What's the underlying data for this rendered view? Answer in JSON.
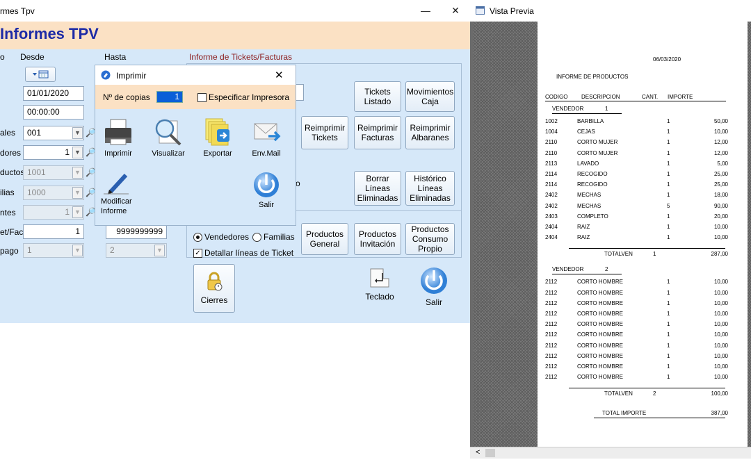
{
  "main": {
    "window_title": "rmes Tpv",
    "minimize": "—",
    "close": "✕",
    "header_title": "Informes TPV",
    "col_desde": "Desde",
    "col_hasta": "Hasta",
    "report_title": "Informe de Tickets/Facturas",
    "desde_date": "01/01/2020",
    "desde_time": "00:00:00",
    "labels": {
      "locales": "ales",
      "vendedores": "dores",
      "productos": "ductos",
      "familias": "ilias",
      "clientes": "ntes",
      "ticket_fac": "et/Fac",
      "forma_pago": "pago"
    },
    "locales_value": "001",
    "vendedores_value": "1",
    "productos_value": "1001",
    "familias_value": "1000",
    "clientes_value": "1",
    "ticket_desde": "1",
    "ticket_hasta": "9999999999",
    "pago_desde": "1",
    "pago_hasta": "2",
    "buttons": {
      "tickets_listado": "Tickets\nListado",
      "movimientos_caja": "Movimientos\nCaja",
      "reimprimir_tickets": "Reimprimir\nTickets",
      "reimprimir_facturas": "Reimprimir\nFacturas",
      "reimprimir_albaranes": "Reimprimir\nAlbaranes",
      "borrar_lineas": "Borrar\nLíneas\nEliminadas",
      "historico_lineas": "Histórico\nLíneas\nEliminadas",
      "productos_general": "Productos\nGeneral",
      "productos_invitacion": "Productos\nInvitación",
      "productos_consumo": "Productos\nConsumo\nPropio",
      "cierres": "Cierres",
      "teclado": "Teclado",
      "salir": "Salir"
    },
    "radio_vendedores": "Vendedores",
    "radio_familias": "Familias",
    "check_detallar": "Detallar líneas de Ticket"
  },
  "dialog": {
    "title": "Imprimir",
    "close": "✕",
    "copies_label": "Nº de copias",
    "copies_value": "1",
    "specify_printer": "Especificar Impresora",
    "actions": {
      "imprimir": "Imprimir",
      "visualizar": "Visualizar",
      "exportar": "Exportar",
      "envmail": "Env.Mail",
      "modificar": "Modificar\nInforme",
      "salir": "Salir"
    }
  },
  "preview": {
    "title": "Vista Previa",
    "scroll_left": "<",
    "report": {
      "date": "06/03/2020",
      "heading": "INFORME DE PRODUCTOS",
      "cols": {
        "codigo": "CODIGO",
        "descripcion": "DESCRIPCION",
        "cant": "CANT.",
        "importe": "IMPORTE"
      },
      "groups": [
        {
          "label": "VENDEDOR",
          "num": "1",
          "rows": [
            {
              "code": "1002",
              "desc": "BARBILLA",
              "qty": "1",
              "amt": "50,00"
            },
            {
              "code": "1004",
              "desc": "CEJAS",
              "qty": "1",
              "amt": "10,00"
            },
            {
              "code": "2110",
              "desc": "CORTO MUJER",
              "qty": "1",
              "amt": "12,00"
            },
            {
              "code": "2110",
              "desc": "CORTO MUJER",
              "qty": "1",
              "amt": "12,00"
            },
            {
              "code": "2113",
              "desc": "LAVADO",
              "qty": "1",
              "amt": "5,00"
            },
            {
              "code": "2114",
              "desc": "RECOGIDO",
              "qty": "1",
              "amt": "25,00"
            },
            {
              "code": "2114",
              "desc": "RECOGIDO",
              "qty": "1",
              "amt": "25,00"
            },
            {
              "code": "2402",
              "desc": "MECHAS",
              "qty": "1",
              "amt": "18,00"
            },
            {
              "code": "2402",
              "desc": "MECHAS",
              "qty": "5",
              "amt": "90,00"
            },
            {
              "code": "2403",
              "desc": "COMPLETO",
              "qty": "1",
              "amt": "20,00"
            },
            {
              "code": "2404",
              "desc": "RAIZ",
              "qty": "1",
              "amt": "10,00"
            },
            {
              "code": "2404",
              "desc": "RAIZ",
              "qty": "1",
              "amt": "10,00"
            }
          ],
          "total_label": "TOTALVEN",
          "total_num": "1",
          "total_amt": "287,00"
        },
        {
          "label": "VENDEDOR",
          "num": "2",
          "rows": [
            {
              "code": "2112",
              "desc": "CORTO HOMBRE",
              "qty": "1",
              "amt": "10,00"
            },
            {
              "code": "2112",
              "desc": "CORTO HOMBRE",
              "qty": "1",
              "amt": "10,00"
            },
            {
              "code": "2112",
              "desc": "CORTO HOMBRE",
              "qty": "1",
              "amt": "10,00"
            },
            {
              "code": "2112",
              "desc": "CORTO HOMBRE",
              "qty": "1",
              "amt": "10,00"
            },
            {
              "code": "2112",
              "desc": "CORTO HOMBRE",
              "qty": "1",
              "amt": "10,00"
            },
            {
              "code": "2112",
              "desc": "CORTO HOMBRE",
              "qty": "1",
              "amt": "10,00"
            },
            {
              "code": "2112",
              "desc": "CORTO HOMBRE",
              "qty": "1",
              "amt": "10,00"
            },
            {
              "code": "2112",
              "desc": "CORTO HOMBRE",
              "qty": "1",
              "amt": "10,00"
            },
            {
              "code": "2112",
              "desc": "CORTO HOMBRE",
              "qty": "1",
              "amt": "10,00"
            },
            {
              "code": "2112",
              "desc": "CORTO HOMBRE",
              "qty": "1",
              "amt": "10,00"
            }
          ],
          "total_label": "TOTALVEN",
          "total_num": "2",
          "total_amt": "100,00"
        }
      ],
      "grand_total_label": "TOTAL IMPORTE",
      "grand_total": "387,00"
    }
  },
  "colors": {
    "header_bg": "#fbe1c4",
    "title_blue": "#1c2aa6",
    "panel_bg": "#d6e8f9",
    "report_red": "#8b1a1a"
  },
  "icons": [
    "calendar-icon",
    "chevron-down-icon",
    "search-icon",
    "printer-icon",
    "magnifier-icon",
    "export-icon",
    "mail-icon",
    "pencil-icon",
    "power-icon",
    "lock-icon",
    "keyboard-return-icon",
    "app-icon"
  ]
}
